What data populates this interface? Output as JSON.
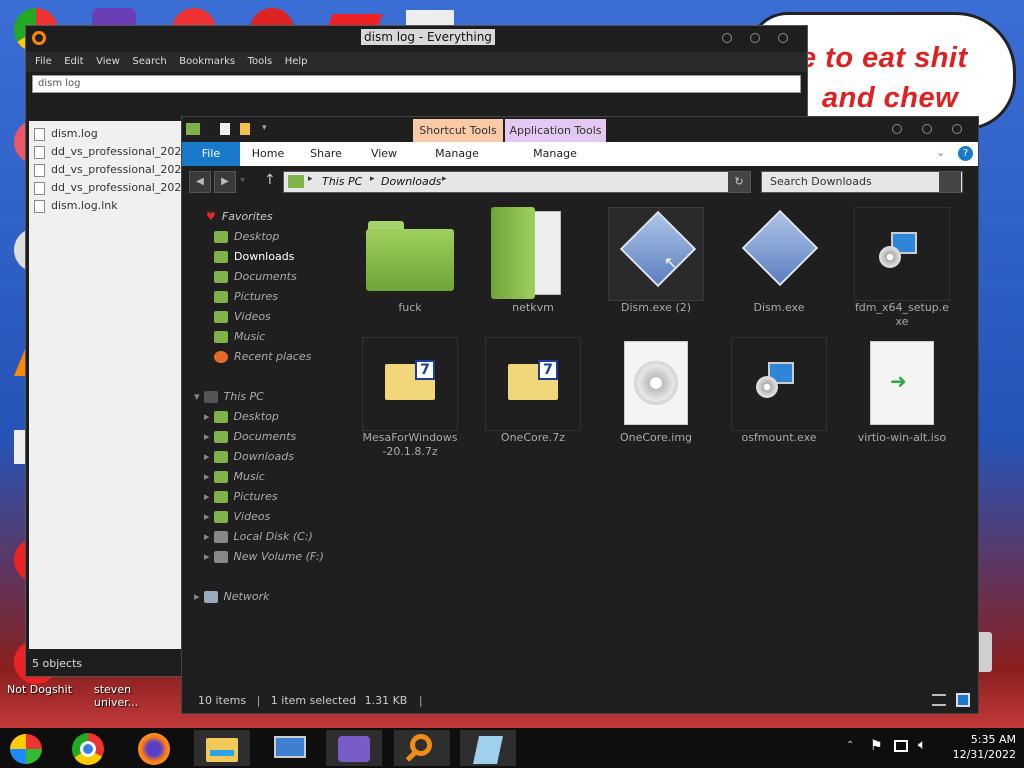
{
  "desktop": {
    "bubble_line1": "e to eat shit",
    "bubble_line2": "and chew",
    "icons": [
      {
        "label": "Not Dogshit"
      },
      {
        "label": "steven univer..."
      }
    ]
  },
  "everything": {
    "title": "dism log - Everything",
    "menu": [
      "File",
      "Edit",
      "View",
      "Search",
      "Bookmarks",
      "Tools",
      "Help"
    ],
    "search_value": "dism log",
    "results": [
      "dism.log",
      "dd_vs_professional_202",
      "dd_vs_professional_202",
      "dd_vs_professional_202",
      "dism.log.lnk"
    ],
    "status": "5 objects"
  },
  "explorer": {
    "context_tabs": [
      {
        "label": "Shortcut Tools",
        "color": "#f9c9a8"
      },
      {
        "label": "Application Tools",
        "color": "#e2c8f2"
      }
    ],
    "ribbon_tabs": [
      "File",
      "Home",
      "Share",
      "View",
      "Manage",
      "Manage"
    ],
    "breadcrumb": [
      "This PC",
      "Downloads"
    ],
    "search_placeholder": "Search Downloads",
    "nav": {
      "favorites": "Favorites",
      "favorites_items": [
        "Desktop",
        "Downloads",
        "Documents",
        "Pictures",
        "Videos",
        "Music",
        "Recent places"
      ],
      "this_pc": "This PC",
      "this_pc_items": [
        "Desktop",
        "Documents",
        "Downloads",
        "Music",
        "Pictures",
        "Videos",
        "Local Disk (C:)",
        "New Volume (F:)"
      ],
      "network": "Network"
    },
    "files": [
      {
        "name": "fuck",
        "icon": "folder-icon"
      },
      {
        "name": "netkvm",
        "icon": "folder-icon"
      },
      {
        "name": "Dism.exe (2)",
        "icon": "app-icon"
      },
      {
        "name": "Dism.exe",
        "icon": "app-icon"
      },
      {
        "name": "fdm_x64_setup.exe",
        "icon": "installer-icon"
      },
      {
        "name": "MesaForWindows-20.1.8.7z",
        "icon": "archive-icon"
      },
      {
        "name": "OneCore.7z",
        "icon": "archive-icon"
      },
      {
        "name": "OneCore.img",
        "icon": "disc-image-icon"
      },
      {
        "name": "osfmount.exe",
        "icon": "installer-icon"
      },
      {
        "name": "virtio-win-alt.iso",
        "icon": "iso-icon"
      }
    ],
    "status_items": "10 items",
    "status_selected": "1 item selected",
    "status_size": "1.31 KB"
  },
  "taskbar": {
    "apps": [
      "start-icon",
      "chrome-icon",
      "firefox-icon",
      "file-explorer-icon",
      "computer-icon",
      "network-icon",
      "everything-search-icon",
      "notepad-icon"
    ],
    "time": "5:35 AM",
    "date": "12/31/2022"
  },
  "colors": {
    "accent": "#1979ca",
    "folder_green": "#8fc85a"
  }
}
